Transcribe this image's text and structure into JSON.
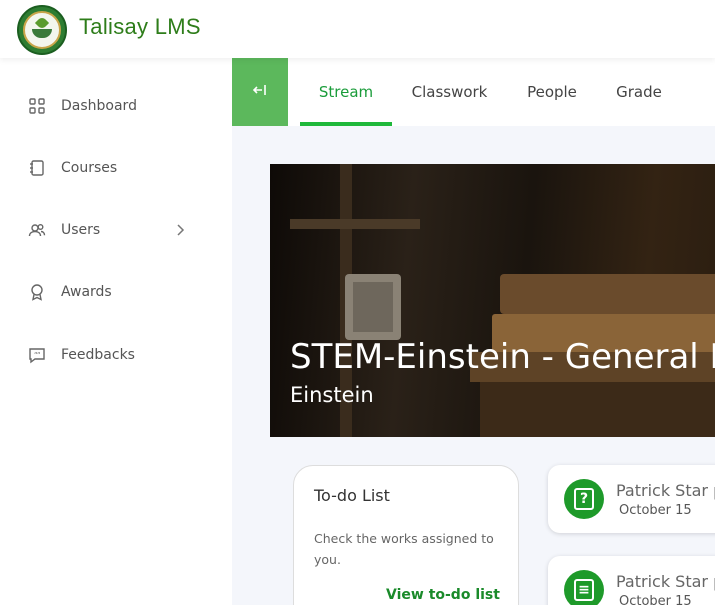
{
  "header": {
    "app_title": "Talisay LMS",
    "logo_icon": "school-seal-logo"
  },
  "sidebar": {
    "items": [
      {
        "label": "Dashboard",
        "icon": "grid-icon"
      },
      {
        "label": "Courses",
        "icon": "book-icon"
      },
      {
        "label": "Users",
        "icon": "users-icon",
        "has_submenu": true
      },
      {
        "label": "Awards",
        "icon": "award-icon"
      },
      {
        "label": "Feedbacks",
        "icon": "chat-quote-icon"
      }
    ]
  },
  "tabs": {
    "collapse_icon": "collapse-left-icon",
    "items": [
      {
        "label": "Stream",
        "active": true
      },
      {
        "label": "Classwork",
        "active": false
      },
      {
        "label": "People",
        "active": false
      },
      {
        "label": "Grade",
        "active": false
      }
    ]
  },
  "banner": {
    "title": "STEM-Einstein - General B",
    "subtitle": "Einstein"
  },
  "todo": {
    "heading": "To-do List",
    "description": "Check the works assigned to you.",
    "link": "View to-do list"
  },
  "posts": [
    {
      "name": "Patrick Star p",
      "date": "October 15",
      "icon": "question-icon"
    },
    {
      "name": "Patrick Star p",
      "date": "October 15",
      "icon": "notebook-icon"
    }
  ],
  "colors": {
    "accent": "#1fb83a",
    "collapse_bg": "#5cb85c",
    "post_icon_bg": "#1e9a2a"
  }
}
